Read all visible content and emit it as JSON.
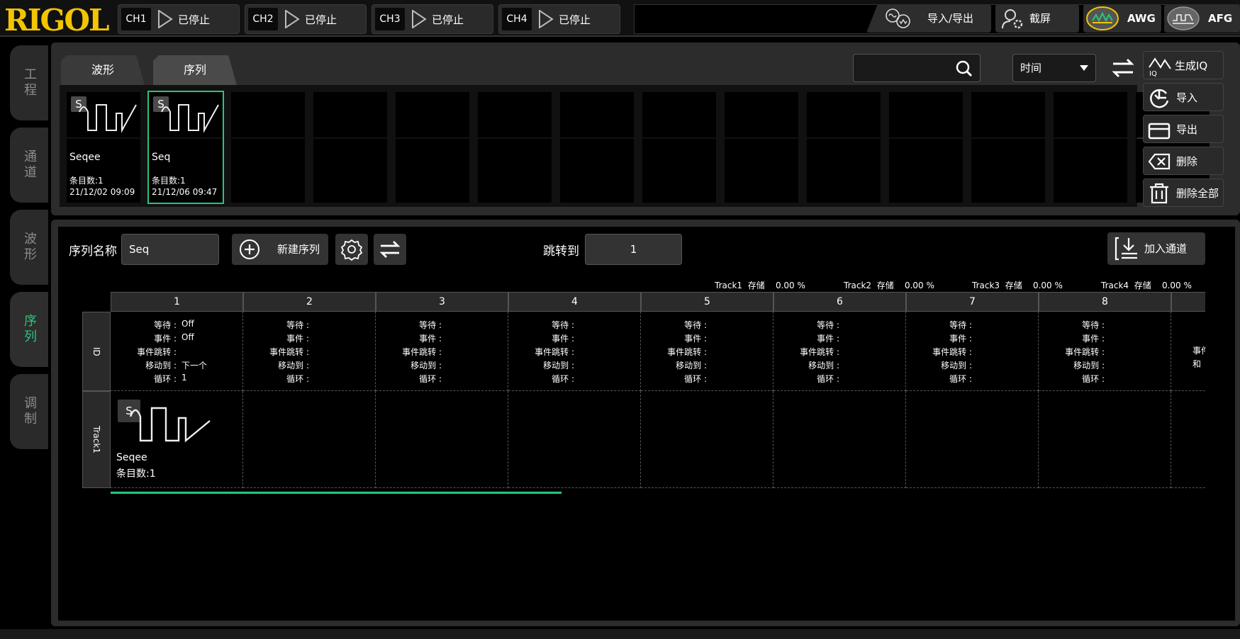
{
  "brand": "RIGOL",
  "channels": [
    {
      "label": "CH1",
      "state": "已停止"
    },
    {
      "label": "CH2",
      "state": "已停止"
    },
    {
      "label": "CH3",
      "state": "已停止"
    },
    {
      "label": "CH4",
      "state": "已停止"
    }
  ],
  "topbar": {
    "import_export": "导入/导出",
    "screenshot": "截屏",
    "awg": "AWG",
    "afg": "AFG"
  },
  "sidebar": {
    "items": [
      {
        "label": "工程"
      },
      {
        "label": "通道"
      },
      {
        "label": "波形"
      },
      {
        "label": "序列",
        "active": true
      },
      {
        "label": "调制"
      }
    ]
  },
  "file_tabs": [
    "波形",
    "序列"
  ],
  "files": [
    {
      "badge": "S",
      "name": "Seqee",
      "count": "条目数:1",
      "date": "21/12/02 09:09"
    },
    {
      "badge": "S",
      "name": "Seq",
      "count": "条目数:1",
      "date": "21/12/06 09:47"
    }
  ],
  "search": {
    "placeholder": ""
  },
  "sort": {
    "selected": "时间"
  },
  "file_actions": {
    "generate_iq": "生成IQ",
    "import": "导入",
    "export": "导出",
    "delete": "删除",
    "delete_all": "删除全部"
  },
  "editor": {
    "seqname_label": "序列名称",
    "seqname_value": "Seq",
    "new_sequence": "新建序列",
    "jump_label": "跳转到",
    "jump_value": "1",
    "add_channel": "加入通道"
  },
  "storage": [
    {
      "track": "Track1",
      "label": "存储",
      "value": "0.00 %"
    },
    {
      "track": "Track2",
      "label": "存储",
      "value": "0.00 %"
    },
    {
      "track": "Track3",
      "label": "存储",
      "value": "0.00 %"
    },
    {
      "track": "Track4",
      "label": "存储",
      "value": "0.00 %"
    }
  ],
  "grid": {
    "columns": [
      "1",
      "2",
      "3",
      "4",
      "5",
      "6",
      "7",
      "8"
    ],
    "row_labels": {
      "id": "ID",
      "track": "Track1"
    },
    "field_labels": [
      "等待",
      "事件",
      "事件跳转",
      "移动到",
      "循环"
    ],
    "col1_values": [
      "Off",
      "Off",
      "",
      "下一个",
      "1"
    ],
    "partial_labels": [
      "事件",
      "和"
    ],
    "track_item": {
      "badge": "S",
      "name": "Seqee",
      "count": "条目数:1"
    }
  },
  "colors": {
    "accent": "#27c77a",
    "brand": "#f2c500"
  }
}
